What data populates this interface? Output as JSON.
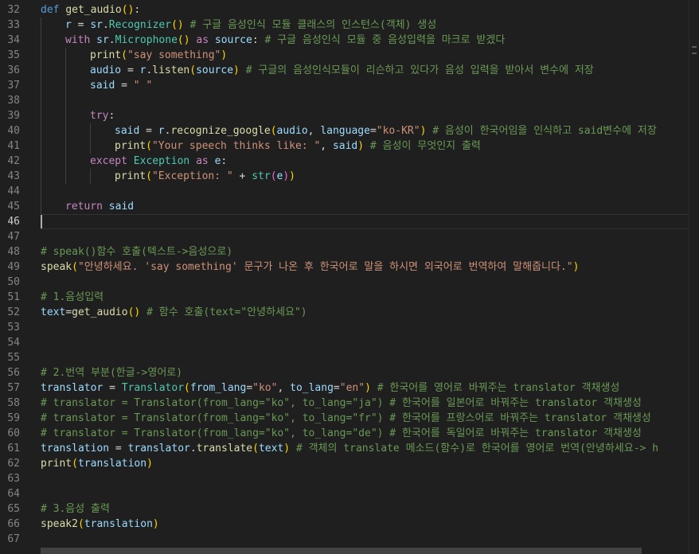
{
  "editor": {
    "active_line": 46,
    "lines": [
      {
        "n": "32",
        "indent": 0,
        "tokens": [
          [
            "kw",
            "def"
          ],
          [
            "op",
            " "
          ],
          [
            "fn",
            "get_audio"
          ],
          [
            "p1",
            "()"
          ],
          [
            "op",
            ":"
          ]
        ]
      },
      {
        "n": "33",
        "indent": 1,
        "tokens": [
          [
            "var",
            "r"
          ],
          [
            "op",
            " = "
          ],
          [
            "var",
            "sr"
          ],
          [
            "op",
            "."
          ],
          [
            "cls",
            "Recognizer"
          ],
          [
            "p1",
            "()"
          ],
          [
            "op",
            " "
          ],
          [
            "com",
            "# 구글 음성인식 모듈 클래스의 인스턴스(객체) 생성"
          ]
        ]
      },
      {
        "n": "34",
        "indent": 1,
        "tokens": [
          [
            "ctl",
            "with"
          ],
          [
            "op",
            " "
          ],
          [
            "var",
            "sr"
          ],
          [
            "op",
            "."
          ],
          [
            "cls",
            "Microphone"
          ],
          [
            "p1",
            "()"
          ],
          [
            "op",
            " "
          ],
          [
            "ctl",
            "as"
          ],
          [
            "op",
            " "
          ],
          [
            "var",
            "source"
          ],
          [
            "op",
            ": "
          ],
          [
            "com",
            "# 구글 음성인식 모듈 중 음성입력을 마크로 받겠다"
          ]
        ]
      },
      {
        "n": "35",
        "indent": 2,
        "tokens": [
          [
            "fn",
            "print"
          ],
          [
            "p1",
            "("
          ],
          [
            "str",
            "\"say something\""
          ],
          [
            "p1",
            ")"
          ]
        ]
      },
      {
        "n": "36",
        "indent": 2,
        "tokens": [
          [
            "var",
            "audio"
          ],
          [
            "op",
            " = "
          ],
          [
            "var",
            "r"
          ],
          [
            "op",
            "."
          ],
          [
            "fn",
            "listen"
          ],
          [
            "p1",
            "("
          ],
          [
            "var",
            "source"
          ],
          [
            "p1",
            ")"
          ],
          [
            "op",
            " "
          ],
          [
            "com",
            "# 구글의 음성인식모듈이 리슨하고 있다가 음성 입력을 받아서 변수에 저장"
          ]
        ]
      },
      {
        "n": "37",
        "indent": 2,
        "tokens": [
          [
            "var",
            "said"
          ],
          [
            "op",
            " = "
          ],
          [
            "str",
            "\" \""
          ]
        ]
      },
      {
        "n": "38",
        "indent": 2,
        "tokens": []
      },
      {
        "n": "39",
        "indent": 2,
        "tokens": [
          [
            "ctl",
            "try"
          ],
          [
            "op",
            ":"
          ]
        ]
      },
      {
        "n": "40",
        "indent": 3,
        "tokens": [
          [
            "var",
            "said"
          ],
          [
            "op",
            " = "
          ],
          [
            "var",
            "r"
          ],
          [
            "op",
            "."
          ],
          [
            "fn",
            "recognize_google"
          ],
          [
            "p1",
            "("
          ],
          [
            "var",
            "audio"
          ],
          [
            "op",
            ", "
          ],
          [
            "var",
            "language"
          ],
          [
            "op",
            "="
          ],
          [
            "str",
            "\"ko-KR\""
          ],
          [
            "p1",
            ")"
          ],
          [
            "op",
            " "
          ],
          [
            "com",
            "# 음성이 한국어임을 인식하고 said변수에 저장"
          ]
        ]
      },
      {
        "n": "41",
        "indent": 3,
        "tokens": [
          [
            "fn",
            "print"
          ],
          [
            "p1",
            "("
          ],
          [
            "str",
            "\"Your speech thinks like: \""
          ],
          [
            "op",
            ", "
          ],
          [
            "var",
            "said"
          ],
          [
            "p1",
            ")"
          ],
          [
            "op",
            " "
          ],
          [
            "com",
            "# 음성이 무엇인지 출력"
          ]
        ]
      },
      {
        "n": "42",
        "indent": 2,
        "tokens": [
          [
            "ctl",
            "except"
          ],
          [
            "op",
            " "
          ],
          [
            "cls",
            "Exception"
          ],
          [
            "op",
            " "
          ],
          [
            "ctl",
            "as"
          ],
          [
            "op",
            " "
          ],
          [
            "var",
            "e"
          ],
          [
            "op",
            ":"
          ]
        ]
      },
      {
        "n": "43",
        "indent": 3,
        "tokens": [
          [
            "fn",
            "print"
          ],
          [
            "p1",
            "("
          ],
          [
            "str",
            "\"Exception: \""
          ],
          [
            "op",
            " + "
          ],
          [
            "cls",
            "str"
          ],
          [
            "p2",
            "("
          ],
          [
            "var",
            "e"
          ],
          [
            "p2",
            ")"
          ],
          [
            "p1",
            ")"
          ]
        ]
      },
      {
        "n": "44",
        "indent": 1,
        "tokens": []
      },
      {
        "n": "45",
        "indent": 1,
        "tokens": [
          [
            "ctl",
            "return"
          ],
          [
            "op",
            " "
          ],
          [
            "var",
            "said"
          ]
        ]
      },
      {
        "n": "46",
        "indent": 0,
        "tokens": []
      },
      {
        "n": "47",
        "indent": 0,
        "tokens": []
      },
      {
        "n": "48",
        "indent": 0,
        "tokens": [
          [
            "com",
            "# speak()함수 호출(텍스트->음성으로)"
          ]
        ]
      },
      {
        "n": "49",
        "indent": 0,
        "tokens": [
          [
            "fn",
            "speak"
          ],
          [
            "p1",
            "("
          ],
          [
            "str",
            "\"안녕하세요. 'say something' 문구가 나온 후 한국어로 말을 하시면 외국어로 번역하여 말해줍니다.\""
          ],
          [
            "p1",
            ")"
          ]
        ]
      },
      {
        "n": "50",
        "indent": 0,
        "tokens": []
      },
      {
        "n": "51",
        "indent": 0,
        "tokens": [
          [
            "com",
            "# 1.음성입력"
          ]
        ]
      },
      {
        "n": "52",
        "indent": 0,
        "tokens": [
          [
            "var",
            "text"
          ],
          [
            "op",
            "="
          ],
          [
            "fn",
            "get_audio"
          ],
          [
            "p1",
            "()"
          ],
          [
            "op",
            " "
          ],
          [
            "com",
            "# 함수 호출(text=\"안녕하세요\")"
          ]
        ]
      },
      {
        "n": "53",
        "indent": 0,
        "tokens": []
      },
      {
        "n": "54",
        "indent": 0,
        "tokens": []
      },
      {
        "n": "55",
        "indent": 0,
        "tokens": []
      },
      {
        "n": "56",
        "indent": 0,
        "tokens": [
          [
            "com",
            "# 2.번역 부분(한글->영어로)"
          ]
        ]
      },
      {
        "n": "57",
        "indent": 0,
        "tokens": [
          [
            "var",
            "translator"
          ],
          [
            "op",
            " = "
          ],
          [
            "cls",
            "Translator"
          ],
          [
            "p1",
            "("
          ],
          [
            "var",
            "from_lang"
          ],
          [
            "op",
            "="
          ],
          [
            "str",
            "\"ko\""
          ],
          [
            "op",
            ", "
          ],
          [
            "var",
            "to_lang"
          ],
          [
            "op",
            "="
          ],
          [
            "str",
            "\"en\""
          ],
          [
            "p1",
            ")"
          ],
          [
            "op",
            " "
          ],
          [
            "com",
            "# 한국어를 영어로 바꿔주는 translator 객채생성"
          ]
        ]
      },
      {
        "n": "58",
        "indent": 0,
        "tokens": [
          [
            "com",
            "# translator = Translator(from_lang=\"ko\", to_lang=\"ja\") # 한국어를 일본어로 바꿔주는 translator 객채생성"
          ]
        ]
      },
      {
        "n": "59",
        "indent": 0,
        "tokens": [
          [
            "com",
            "# translator = Translator(from_lang=\"ko\", to_lang=\"fr\") # 한국어를 프랑스어로 바꿔주는 translator 객채생성"
          ]
        ]
      },
      {
        "n": "60",
        "indent": 0,
        "tokens": [
          [
            "com",
            "# translator = Translator(from_lang=\"ko\", to_lang=\"de\") # 한국어를 독일어로 바꿔주는 translator 객채생성"
          ]
        ]
      },
      {
        "n": "61",
        "indent": 0,
        "tokens": [
          [
            "var",
            "translation"
          ],
          [
            "op",
            " = "
          ],
          [
            "var",
            "translator"
          ],
          [
            "op",
            "."
          ],
          [
            "fn",
            "translate"
          ],
          [
            "p1",
            "("
          ],
          [
            "var",
            "text"
          ],
          [
            "p1",
            ")"
          ],
          [
            "op",
            " "
          ],
          [
            "com",
            "# 객체의 translate 메소드(함수)로 한국어를 영어로 번역(안녕하세요-> h"
          ]
        ]
      },
      {
        "n": "62",
        "indent": 0,
        "tokens": [
          [
            "fn",
            "print"
          ],
          [
            "p1",
            "("
          ],
          [
            "var",
            "translation"
          ],
          [
            "p1",
            ")"
          ]
        ]
      },
      {
        "n": "63",
        "indent": 0,
        "tokens": []
      },
      {
        "n": "64",
        "indent": 0,
        "tokens": []
      },
      {
        "n": "65",
        "indent": 0,
        "tokens": [
          [
            "com",
            "# 3.음성 출력"
          ]
        ]
      },
      {
        "n": "66",
        "indent": 0,
        "tokens": [
          [
            "fn",
            "speak2"
          ],
          [
            "p1",
            "("
          ],
          [
            "var",
            "translation"
          ],
          [
            "p1",
            ")"
          ]
        ]
      },
      {
        "n": "67",
        "indent": 0,
        "tokens": []
      }
    ]
  }
}
